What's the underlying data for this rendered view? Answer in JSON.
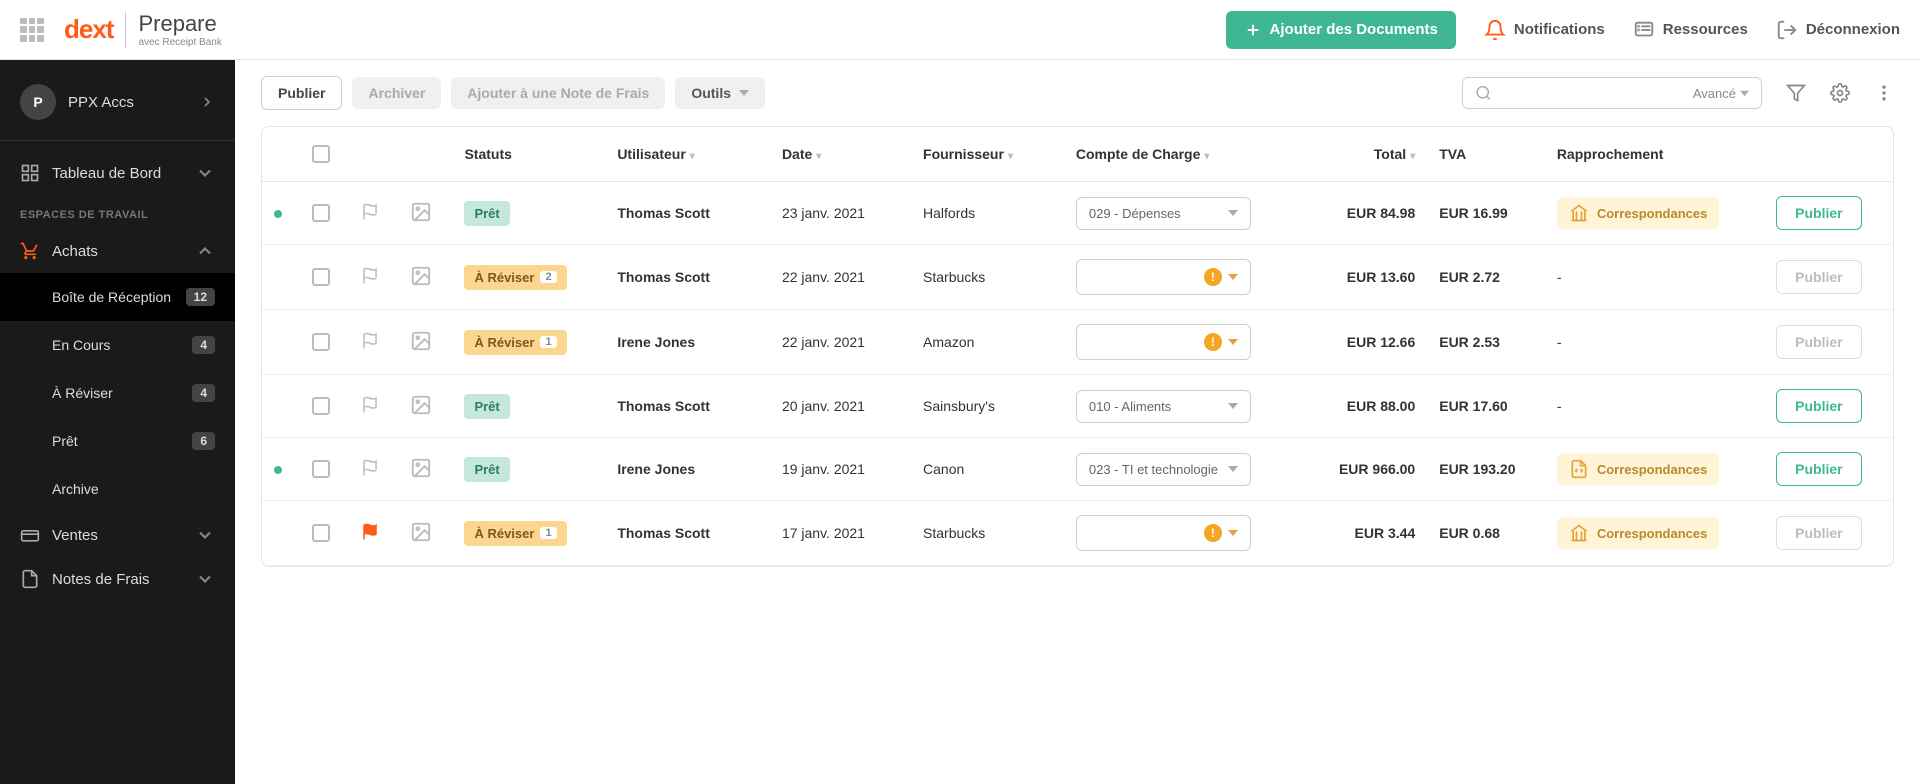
{
  "header": {
    "logo_brand": "dext",
    "logo_product": "Prepare",
    "logo_sub": "avec Receipt Bank",
    "add_btn": "Ajouter des Documents",
    "notifications": "Notifications",
    "resources": "Ressources",
    "logout": "Déconnexion"
  },
  "sidebar": {
    "account_initial": "P",
    "account_name": "PPX Accs",
    "dashboard": "Tableau de Bord",
    "workspaces_label": "ESPACES DE TRAVAIL",
    "achats": "Achats",
    "inbox": "Boîte de Réception",
    "inbox_count": "12",
    "en_cours": "En Cours",
    "en_cours_count": "4",
    "a_reviser": "À Réviser",
    "a_reviser_count": "4",
    "pret": "Prêt",
    "pret_count": "6",
    "archive": "Archive",
    "ventes": "Ventes",
    "notes": "Notes de Frais"
  },
  "toolbar": {
    "publier": "Publier",
    "archiver": "Archiver",
    "ajouter_note": "Ajouter à une Note de Frais",
    "outils": "Outils",
    "avance": "Avancé"
  },
  "columns": {
    "statuts": "Statuts",
    "utilisateur": "Utilisateur",
    "date": "Date",
    "fournisseur": "Fournisseur",
    "compte": "Compte de Charge",
    "total": "Total",
    "tva": "TVA",
    "rapprochement": "Rapprochement"
  },
  "status_labels": {
    "pret": "Prêt",
    "a_reviser": "À Réviser"
  },
  "rows": [
    {
      "dot": true,
      "flagged": false,
      "status": "pret",
      "count": null,
      "user": "Thomas Scott",
      "date": "23 janv. 2021",
      "fournisseur": "Halfords",
      "compte": "029 - Dépenses",
      "warn": false,
      "total": "EUR 84.98",
      "tva": "EUR 16.99",
      "rapp": "Correspondances",
      "rapp_icon": "bank",
      "publish_enabled": true
    },
    {
      "dot": false,
      "flagged": false,
      "status": "rev",
      "count": "2",
      "user": "Thomas Scott",
      "date": "22 janv. 2021",
      "fournisseur": "Starbucks",
      "compte": "",
      "warn": true,
      "total": "EUR 13.60",
      "tva": "EUR 2.72",
      "rapp": "-",
      "rapp_icon": null,
      "publish_enabled": false
    },
    {
      "dot": false,
      "flagged": false,
      "status": "rev",
      "count": "1",
      "user": "Irene Jones",
      "date": "22 janv. 2021",
      "fournisseur": "Amazon",
      "compte": "",
      "warn": true,
      "total": "EUR 12.66",
      "tva": "EUR 2.53",
      "rapp": "-",
      "rapp_icon": null,
      "publish_enabled": false
    },
    {
      "dot": false,
      "flagged": false,
      "status": "pret",
      "count": null,
      "user": "Thomas Scott",
      "date": "20 janv. 2021",
      "fournisseur": "Sainsbury's",
      "compte": "010 - Aliments",
      "warn": false,
      "total": "EUR 88.00",
      "tva": "EUR 17.60",
      "rapp": "-",
      "rapp_icon": null,
      "publish_enabled": true
    },
    {
      "dot": true,
      "flagged": false,
      "status": "pret",
      "count": null,
      "user": "Irene Jones",
      "date": "19 janv. 2021",
      "fournisseur": "Canon",
      "compte": "023 - TI et technologie",
      "warn": false,
      "total": "EUR 966.00",
      "tva": "EUR 193.20",
      "rapp": "Correspondances",
      "rapp_icon": "doc",
      "publish_enabled": true
    },
    {
      "dot": false,
      "flagged": true,
      "status": "rev",
      "count": "1",
      "user": "Thomas Scott",
      "date": "17 janv. 2021",
      "fournisseur": "Starbucks",
      "compte": "",
      "warn": true,
      "total": "EUR 3.44",
      "tva": "EUR 0.68",
      "rapp": "Correspondances",
      "rapp_icon": "bank",
      "publish_enabled": false
    }
  ],
  "btn_publish": "Publier"
}
